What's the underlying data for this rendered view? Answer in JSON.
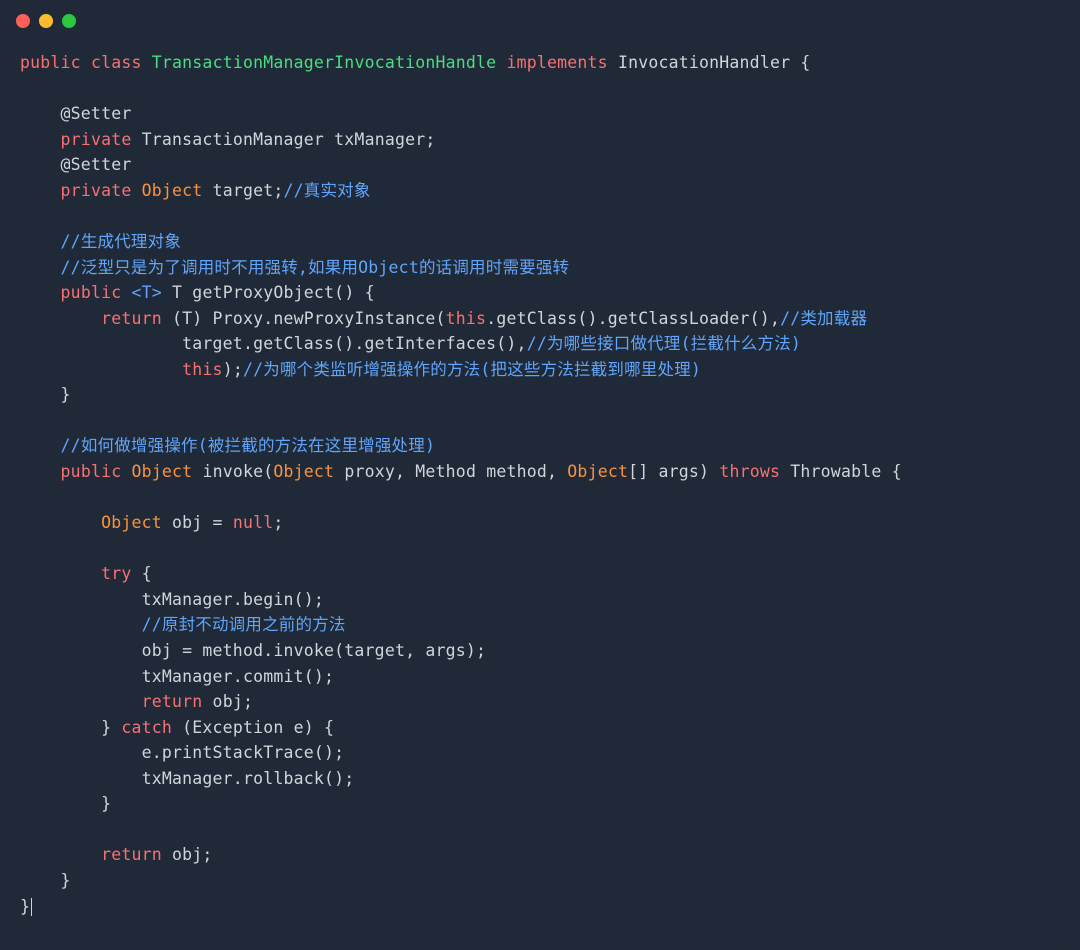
{
  "titlebar": {
    "dots": [
      "red",
      "yellow",
      "green"
    ]
  },
  "code": {
    "tokens": [
      [
        {
          "c": "kw-red",
          "t": "public"
        },
        {
          "c": "txt-default",
          "t": " "
        },
        {
          "c": "kw-red",
          "t": "class"
        },
        {
          "c": "txt-default",
          "t": " "
        },
        {
          "c": "kw-green",
          "t": "TransactionManagerInvocationHandle"
        },
        {
          "c": "txt-default",
          "t": " "
        },
        {
          "c": "kw-red",
          "t": "implements"
        },
        {
          "c": "txt-default",
          "t": " InvocationHandler {"
        }
      ],
      [
        {
          "c": "txt-default",
          "t": ""
        }
      ],
      [
        {
          "c": "txt-default",
          "t": "    @Setter"
        }
      ],
      [
        {
          "c": "txt-default",
          "t": "    "
        },
        {
          "c": "kw-red",
          "t": "private"
        },
        {
          "c": "txt-default",
          "t": " TransactionManager txManager;"
        }
      ],
      [
        {
          "c": "txt-default",
          "t": "    @Setter"
        }
      ],
      [
        {
          "c": "txt-default",
          "t": "    "
        },
        {
          "c": "kw-red",
          "t": "private"
        },
        {
          "c": "txt-default",
          "t": " "
        },
        {
          "c": "kw-orange",
          "t": "Object"
        },
        {
          "c": "txt-default",
          "t": " target;"
        },
        {
          "c": "kw-blue",
          "t": "//真实对象"
        }
      ],
      [
        {
          "c": "txt-default",
          "t": ""
        }
      ],
      [
        {
          "c": "txt-default",
          "t": "    "
        },
        {
          "c": "kw-blue",
          "t": "//生成代理对象"
        }
      ],
      [
        {
          "c": "txt-default",
          "t": "    "
        },
        {
          "c": "kw-blue",
          "t": "//泛型只是为了调用时不用强转,如果用Object的话调用时需要强转"
        }
      ],
      [
        {
          "c": "txt-default",
          "t": "    "
        },
        {
          "c": "kw-red",
          "t": "public"
        },
        {
          "c": "txt-default",
          "t": " "
        },
        {
          "c": "kw-blue",
          "t": "<T>"
        },
        {
          "c": "txt-default",
          "t": " T getProxyObject() {"
        }
      ],
      [
        {
          "c": "txt-default",
          "t": "        "
        },
        {
          "c": "kw-red",
          "t": "return"
        },
        {
          "c": "txt-default",
          "t": " (T) Proxy.newProxyInstance("
        },
        {
          "c": "kw-red",
          "t": "this"
        },
        {
          "c": "txt-default",
          "t": ".getClass().getClassLoader(),"
        },
        {
          "c": "kw-blue",
          "t": "//类加载器"
        }
      ],
      [
        {
          "c": "txt-default",
          "t": "                target.getClass().getInterfaces(),"
        },
        {
          "c": "kw-blue",
          "t": "//为哪些接口做代理(拦截什么方法)"
        }
      ],
      [
        {
          "c": "txt-default",
          "t": "                "
        },
        {
          "c": "kw-red",
          "t": "this"
        },
        {
          "c": "txt-default",
          "t": ");"
        },
        {
          "c": "kw-blue",
          "t": "//为哪个类监听增强操作的方法(把这些方法拦截到哪里处理)"
        }
      ],
      [
        {
          "c": "txt-default",
          "t": "    }"
        }
      ],
      [
        {
          "c": "txt-default",
          "t": ""
        }
      ],
      [
        {
          "c": "txt-default",
          "t": "    "
        },
        {
          "c": "kw-blue",
          "t": "//如何做增强操作(被拦截的方法在这里增强处理)"
        }
      ],
      [
        {
          "c": "txt-default",
          "t": "    "
        },
        {
          "c": "kw-red",
          "t": "public"
        },
        {
          "c": "txt-default",
          "t": " "
        },
        {
          "c": "kw-orange",
          "t": "Object"
        },
        {
          "c": "txt-default",
          "t": " invoke("
        },
        {
          "c": "kw-orange",
          "t": "Object"
        },
        {
          "c": "txt-default",
          "t": " proxy, Method method, "
        },
        {
          "c": "kw-orange",
          "t": "Object"
        },
        {
          "c": "txt-default",
          "t": "[] args) "
        },
        {
          "c": "kw-red",
          "t": "throws"
        },
        {
          "c": "txt-default",
          "t": " Throwable {"
        }
      ],
      [
        {
          "c": "txt-default",
          "t": ""
        }
      ],
      [
        {
          "c": "txt-default",
          "t": "        "
        },
        {
          "c": "kw-orange",
          "t": "Object"
        },
        {
          "c": "txt-default",
          "t": " obj = "
        },
        {
          "c": "kw-red",
          "t": "null"
        },
        {
          "c": "txt-default",
          "t": ";"
        }
      ],
      [
        {
          "c": "txt-default",
          "t": ""
        }
      ],
      [
        {
          "c": "txt-default",
          "t": "        "
        },
        {
          "c": "kw-red",
          "t": "try"
        },
        {
          "c": "txt-default",
          "t": " {"
        }
      ],
      [
        {
          "c": "txt-default",
          "t": "            txManager.begin();"
        }
      ],
      [
        {
          "c": "txt-default",
          "t": "            "
        },
        {
          "c": "kw-blue",
          "t": "//原封不动调用之前的方法"
        }
      ],
      [
        {
          "c": "txt-default",
          "t": "            obj = method.invoke(target, args);"
        }
      ],
      [
        {
          "c": "txt-default",
          "t": "            txManager.commit();"
        }
      ],
      [
        {
          "c": "txt-default",
          "t": "            "
        },
        {
          "c": "kw-red",
          "t": "return"
        },
        {
          "c": "txt-default",
          "t": " obj;"
        }
      ],
      [
        {
          "c": "txt-default",
          "t": "        } "
        },
        {
          "c": "kw-red",
          "t": "catch"
        },
        {
          "c": "txt-default",
          "t": " (Exception e) {"
        }
      ],
      [
        {
          "c": "txt-default",
          "t": "            e.printStackTrace();"
        }
      ],
      [
        {
          "c": "txt-default",
          "t": "            txManager.rollback();"
        }
      ],
      [
        {
          "c": "txt-default",
          "t": "        }"
        }
      ],
      [
        {
          "c": "txt-default",
          "t": ""
        }
      ],
      [
        {
          "c": "txt-default",
          "t": "        "
        },
        {
          "c": "kw-red",
          "t": "return"
        },
        {
          "c": "txt-default",
          "t": " obj;"
        }
      ],
      [
        {
          "c": "txt-default",
          "t": "    }"
        }
      ],
      [
        {
          "c": "txt-default",
          "t": "}"
        }
      ]
    ]
  }
}
